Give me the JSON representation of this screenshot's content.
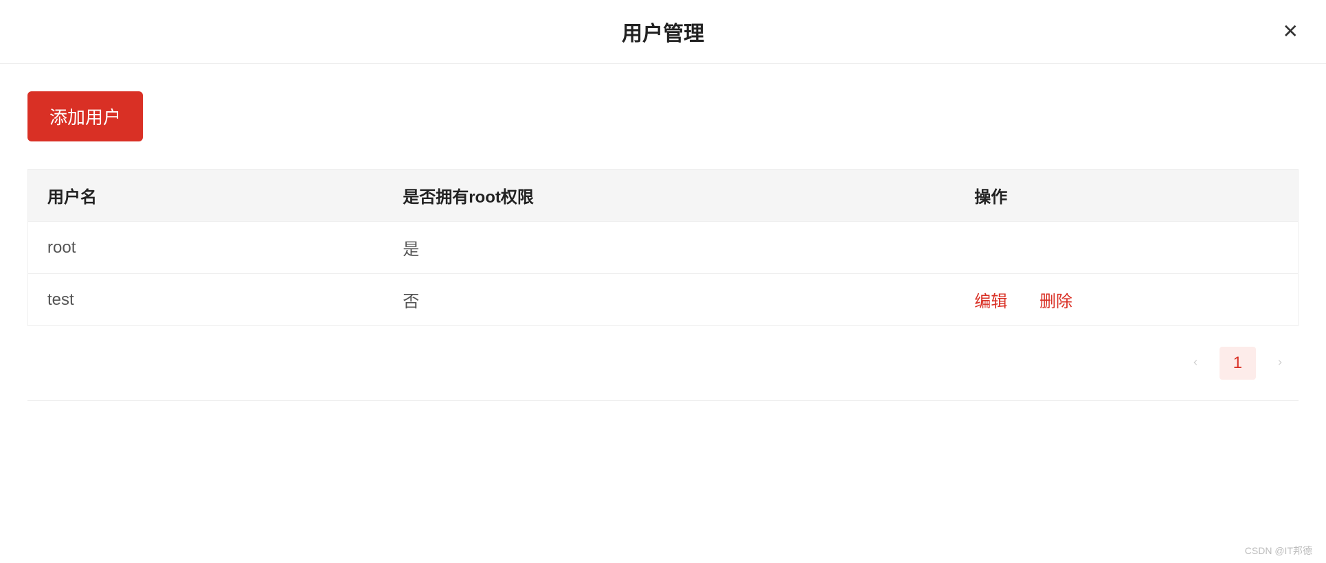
{
  "header": {
    "title": "用户管理"
  },
  "toolbar": {
    "add_user_label": "添加用户"
  },
  "table": {
    "columns": {
      "username": "用户名",
      "has_root": "是否拥有root权限",
      "action": "操作"
    },
    "rows": [
      {
        "username": "root",
        "has_root": "是",
        "edit": "",
        "delete": ""
      },
      {
        "username": "test",
        "has_root": "否",
        "edit": "编辑",
        "delete": "删除"
      }
    ]
  },
  "pagination": {
    "current": "1"
  },
  "watermark": "CSDN @IT邦德"
}
